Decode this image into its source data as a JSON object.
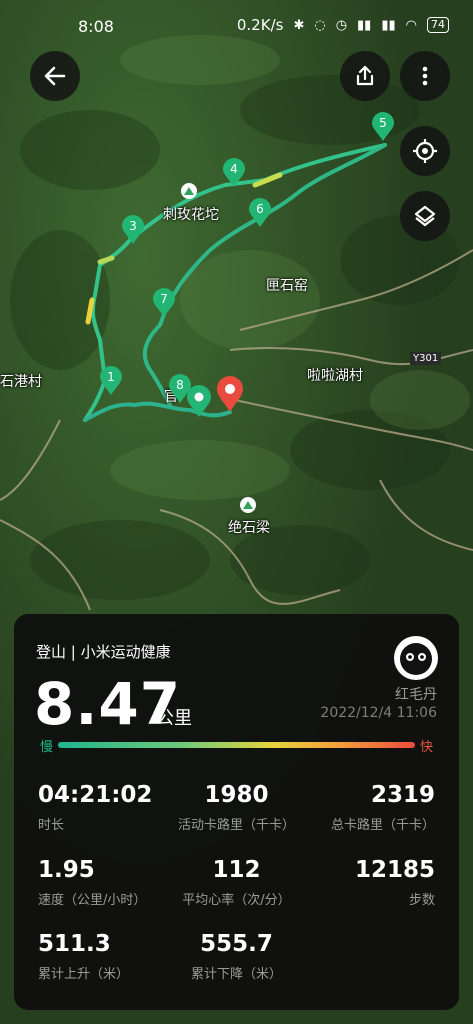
{
  "status_bar": {
    "time": "8:08",
    "speed": "0.2K/s",
    "battery": "74"
  },
  "map": {
    "pois": [
      "刺玫花坨",
      "匣石窑",
      "石港村",
      "啦啦湖村",
      "Y301",
      "绝石梁",
      "官"
    ],
    "markers": [
      "1",
      "3",
      "4",
      "5",
      "6",
      "7",
      "8"
    ]
  },
  "panel": {
    "title": "登山 | 小米运动健康",
    "distance": "8.47",
    "distance_unit": "公里",
    "user_name": "红毛丹",
    "datetime": "2022/12/4 11:06",
    "slow_label": "慢",
    "fast_label": "快",
    "stats": [
      {
        "value": "04:21:02",
        "label": "时长"
      },
      {
        "value": "1980",
        "label": "活动卡路里（千卡）"
      },
      {
        "value": "2319",
        "label": "总卡路里（千卡）"
      },
      {
        "value": "1.95",
        "label": "速度（公里/小时）"
      },
      {
        "value": "112",
        "label": "平均心率（次/分）"
      },
      {
        "value": "12185",
        "label": "步数"
      },
      {
        "value": "511.3",
        "label": "累计上升（米）"
      },
      {
        "value": "555.7",
        "label": "累计下降（米）"
      }
    ]
  },
  "colors": {
    "track_slow": "#1fb58f",
    "track_fast": "#ea4b3e",
    "marker": "#22b573"
  }
}
